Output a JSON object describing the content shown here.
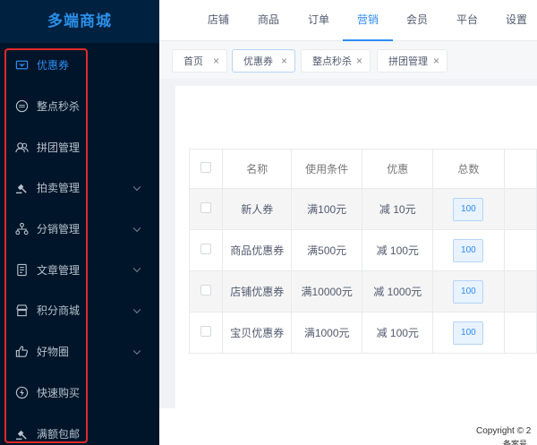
{
  "app": {
    "title": "多端商城"
  },
  "sidebar": {
    "items": [
      {
        "label": "优惠券",
        "icon": "coupon-icon",
        "active": true,
        "has_children": false
      },
      {
        "label": "整点秒杀",
        "icon": "seckill-icon",
        "active": false,
        "has_children": false
      },
      {
        "label": "拼团管理",
        "icon": "group-icon",
        "active": false,
        "has_children": false
      },
      {
        "label": "拍卖管理",
        "icon": "auction-icon",
        "active": false,
        "has_children": true
      },
      {
        "label": "分销管理",
        "icon": "distribution-icon",
        "active": false,
        "has_children": true
      },
      {
        "label": "文章管理",
        "icon": "article-icon",
        "active": false,
        "has_children": true
      },
      {
        "label": "积分商城",
        "icon": "store-icon",
        "active": false,
        "has_children": true
      },
      {
        "label": "好物圈",
        "icon": "thumb-up-icon",
        "active": false,
        "has_children": true
      },
      {
        "label": "快速购买",
        "icon": "lightning-icon",
        "active": false,
        "has_children": false
      },
      {
        "label": "满额包邮",
        "icon": "gavel-icon",
        "active": false,
        "has_children": false
      }
    ]
  },
  "topnav": {
    "items": [
      "店铺",
      "商品",
      "订单",
      "营销",
      "会员",
      "平台",
      "设置"
    ],
    "active": "营销"
  },
  "tags": [
    {
      "label": "首页",
      "active": false
    },
    {
      "label": "优惠券",
      "active": true
    },
    {
      "label": "整点秒杀",
      "active": false
    },
    {
      "label": "拼团管理",
      "active": false
    }
  ],
  "table": {
    "columns": [
      "名称",
      "使用条件",
      "优惠",
      "总数"
    ],
    "rows": [
      {
        "name": "新人券",
        "condition": "满100元",
        "discount": "减 10元",
        "total": "100"
      },
      {
        "name": "商品优惠券",
        "condition": "满500元",
        "discount": "减 100元",
        "total": "100"
      },
      {
        "name": "店铺优惠券",
        "condition": "满10000元",
        "discount": "减 1000元",
        "total": "100"
      },
      {
        "name": "宝贝优惠券",
        "condition": "满1000元",
        "discount": "减 100元",
        "total": "100"
      }
    ]
  },
  "footer": {
    "copyright": "Copyright © 2",
    "beian": "备案号"
  },
  "colors": {
    "sidebar_bg": "#001529",
    "accent": "#2d8cf0",
    "highlight_box": "#e02a2a"
  }
}
